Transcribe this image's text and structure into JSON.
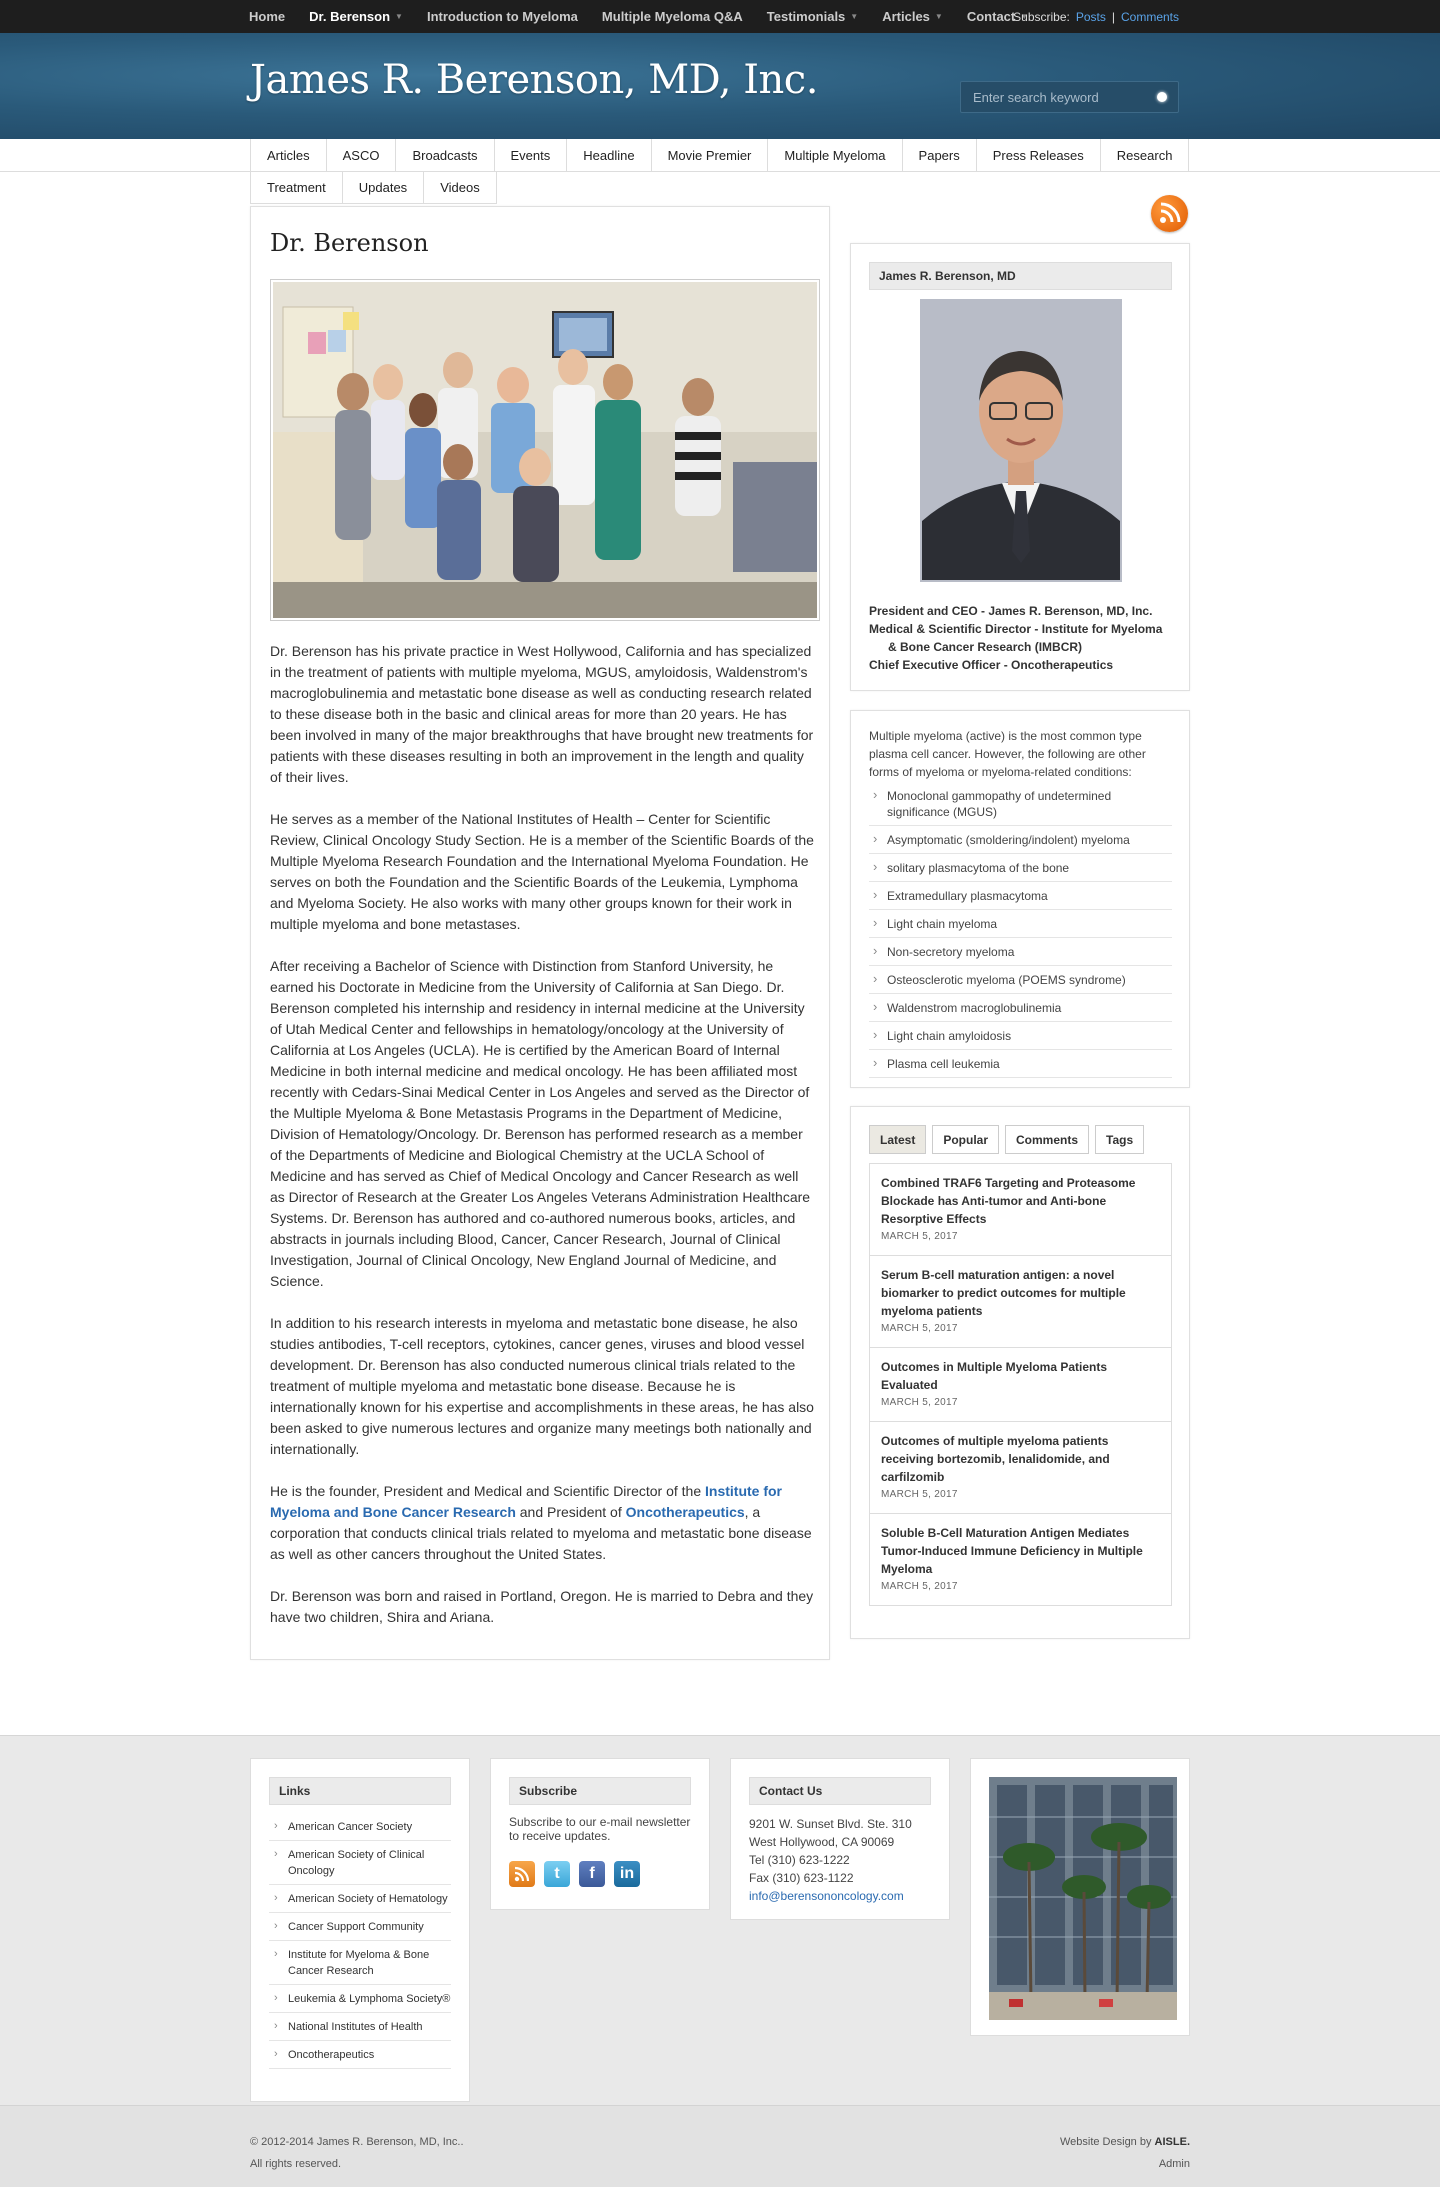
{
  "topnav": {
    "items": [
      {
        "label": "Home",
        "caret": false
      },
      {
        "label": "Dr. Berenson",
        "caret": true,
        "active": true
      },
      {
        "label": "Introduction to Myeloma",
        "caret": false
      },
      {
        "label": "Multiple Myeloma Q&A",
        "caret": false
      },
      {
        "label": "Testimonials",
        "caret": true
      },
      {
        "label": "Articles",
        "caret": true
      },
      {
        "label": "Contact",
        "caret": true
      }
    ],
    "subscribe_label": "Subscribe:",
    "posts_label": "Posts",
    "separator": "|",
    "comments_label": "Comments"
  },
  "header": {
    "site_title": "James R. Berenson, MD, Inc.",
    "search_placeholder": "Enter search keyword"
  },
  "catnav": {
    "row1": [
      "Articles",
      "ASCO",
      "Broadcasts",
      "Events",
      "Headline",
      "Movie Premier",
      "Multiple Myeloma",
      "Papers",
      "Press Releases",
      "Research"
    ],
    "row2": [
      "Treatment",
      "Updates",
      "Videos"
    ]
  },
  "main": {
    "title": "Dr. Berenson",
    "p1": "Dr. Berenson has his private practice in West Hollywood, California and has specialized in the treatment of patients with multiple myeloma, MGUS, amyloidosis, Waldenstrom's macroglobulinemia and metastatic bone disease as well as conducting research related to these disease both in the basic and clinical areas for more than 20 years. He has been involved in many of the major breakthroughs that have brought new treatments for patients with these diseases resulting in both an improvement in the length and quality of their lives.",
    "p2": "He serves as a member of the National Institutes of Health – Center for Scientific Review, Clinical Oncology Study Section. He is a member of the Scientific Boards of the Multiple Myeloma Research Foundation and the International Myeloma Foundation. He serves on both the Foundation and the Scientific Boards of the Leukemia, Lymphoma and Myeloma Society. He also works with many other groups known for their work in multiple myeloma and bone metastases.",
    "p3": "After receiving a Bachelor of Science with Distinction from Stanford University, he earned his Doctorate in Medicine from the University of California at San Diego. Dr. Berenson completed his internship and residency in internal medicine at the University of Utah Medical Center and fellowships in hematology/oncology at the University of California at Los Angeles (UCLA). He is certified by the American Board of Internal Medicine in both internal medicine and medical oncology. He has been affiliated most recently with Cedars-Sinai Medical Center in Los Angeles and served as the Director of the Multiple Myeloma & Bone Metastasis Programs in the Department of Medicine, Division of Hematology/Oncology. Dr. Berenson has performed research as a member of the Departments of Medicine and Biological Chemistry at the UCLA School of Medicine and has served as Chief of Medical Oncology and Cancer Research as well as Director of Research at the Greater Los Angeles Veterans Administration Healthcare Systems. Dr. Berenson has authored and co-authored numerous books, articles, and abstracts in journals including Blood, Cancer, Cancer Research, Journal of Clinical Investigation, Journal of Clinical Oncology, New England Journal of Medicine, and Science.",
    "p4": "In addition to his research interests in myeloma and metastatic bone disease, he also studies antibodies, T-cell receptors, cytokines, cancer genes, viruses and blood vessel development. Dr. Berenson has also conducted numerous clinical trials related to the treatment of multiple myeloma and metastatic bone disease. Because he is internationally known for his expertise and accomplishments in these areas, he has also been asked to give numerous lectures and organize many meetings both nationally and internationally.",
    "p5_a": "He is the founder, President and Medical and Scientific Director of the ",
    "p5_link1": "Institute for Myeloma and Bone Cancer Research",
    "p5_b": " and President of ",
    "p5_link2": "Oncotherapeutics",
    "p5_c": ", a corporation that conducts clinical trials related to myeloma and metastatic bone disease as well as other cancers throughout the United States.",
    "p6": "Dr. Berenson was born and raised in Portland, Oregon. He is married to Debra and they have two children, Shira and Ariana."
  },
  "sidebar": {
    "profile_head": "James R. Berenson, MD",
    "role1": "President and CEO - James R. Berenson, MD, Inc.",
    "role2": "Medical & Scientific Director - Institute for Myeloma",
    "role2b": "& Bone Cancer Research (IMBCR)",
    "role3": "Chief Executive Officer - Oncotherapeutics",
    "cond_intro": "Multiple myeloma (active) is the most common type plasma cell cancer. However, the following are other forms of myeloma or myeloma-related conditions:",
    "conditions": [
      "Monoclonal gammopathy of undetermined significance (MGUS)",
      "Asymptomatic (smoldering/indolent) myeloma",
      "solitary plasmacytoma of the bone",
      "Extramedullary plasmacytoma",
      "Light chain myeloma",
      "Non-secretory myeloma",
      "Osteosclerotic myeloma (POEMS syndrome)",
      "Waldenstrom macroglobulinemia",
      "Light chain amyloidosis",
      "Plasma cell leukemia"
    ],
    "tabs": [
      "Latest",
      "Popular",
      "Comments",
      "Tags"
    ],
    "posts": [
      {
        "title": "Combined TRAF6 Targeting and Proteasome Blockade has Anti-tumor and Anti-bone Resorptive Effects",
        "date": "MARCH 5, 2017"
      },
      {
        "title": "Serum B-cell maturation antigen: a novel biomarker to predict outcomes for multiple myeloma patients",
        "date": "MARCH 5, 2017"
      },
      {
        "title": "Outcomes in Multiple Myeloma Patients Evaluated",
        "date": "MARCH 5, 2017"
      },
      {
        "title": "Outcomes of multiple myeloma patients receiving bortezomib, lenalidomide, and carfilzomib",
        "date": "MARCH 5, 2017"
      },
      {
        "title": "Soluble B-Cell Maturation Antigen Mediates Tumor-Induced Immune Deficiency in Multiple Myeloma",
        "date": "MARCH 5, 2017"
      }
    ]
  },
  "footer": {
    "links_head": "Links",
    "links": [
      "American Cancer Society",
      "American Society of Clinical Oncology",
      "American Society of Hematology",
      "Cancer Support Community",
      "Institute for Myeloma & Bone Cancer Research",
      "Leukemia & Lymphoma Society®",
      "National Institutes of Health",
      "Oncotherapeutics"
    ],
    "subscribe_head": "Subscribe",
    "subscribe_text": "Subscribe to our e-mail newsletter to receive updates.",
    "social_icons": [
      "rss-icon",
      "twitter-icon",
      "facebook-icon",
      "linkedin-icon"
    ],
    "contact_head": "Contact Us",
    "address1": "9201 W. Sunset Blvd. Ste. 310",
    "address2": "West Hollywood, CA 90069",
    "tel": "Tel  (310) 623-1222",
    "fax": "Fax (310) 623-1122",
    "email": "info@berensononcology.com",
    "copyright": "© 2012-2014 James R. Berenson, MD, Inc..",
    "rights": "All rights reserved.",
    "design_prefix": "Website Design by ",
    "design_by": "AISLE.",
    "admin": "Admin"
  },
  "colors": {
    "header_blue": "#2a5a7a",
    "link_blue": "#2a6ab0",
    "rss_orange": "#e86a10"
  }
}
